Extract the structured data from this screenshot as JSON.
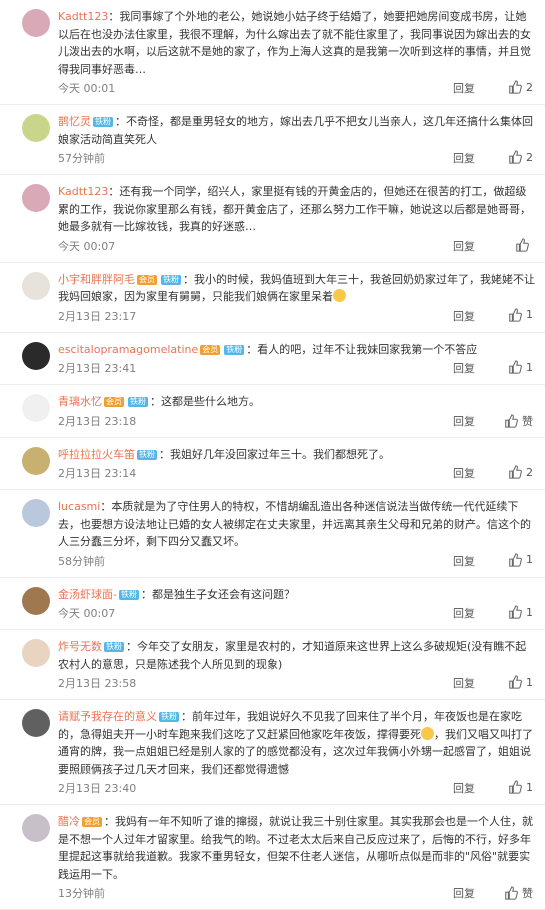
{
  "reply_label": "回复",
  "comments": [
    {
      "user": "Kadtt123",
      "badges": [],
      "text": "：我同事嫁了个外地的老公，她说她小姑子终于结婚了，她要把她房间变成书房，让她以后在也没办法住家里，我很不理解，为什么嫁出去了就不能住家里了，我同事说因为嫁出去的女儿泼出去的水啊，以后这就不是她的家了，作为上海人这真的是我第一次听到这样的事情，并且觉得我同事好恶毒…",
      "time": "今天 00:01",
      "likes": "2"
    },
    {
      "user": "鹊忆灵",
      "badges": [
        "铁粉"
      ],
      "text": "：不奇怪，都是重男轻女的地方，嫁出去几乎不把女儿当亲人，这几年还搞什么集体回娘家活动简直笑死人",
      "time": "57分钟前",
      "likes": "2"
    },
    {
      "user": "Kadtt123",
      "badges": [],
      "text": "：还有我一个同学，绍兴人，家里挺有钱的开黄金店的，但她还在很苦的打工，做超级累的工作，我说你家里那么有钱，都开黄金店了，还那么努力工作干嘛，她说这以后都是她哥哥，她最多就有一比嫁妆钱，我真的好迷惑…",
      "time": "今天 00:07",
      "likes": ""
    },
    {
      "user": "小宇和胖胖阿毛",
      "badges": [
        "会员",
        "铁粉"
      ],
      "text": "：我小的时候，我妈值班到大年三十，我爸回奶奶家过年了，我姥姥不让我妈回娘家，因为家里有舅舅，只能我们娘俩在家里呆着",
      "time": "2月13日 23:17",
      "likes": "1",
      "emoji": true
    },
    {
      "user": "escitalopramagomelatine",
      "badges": [
        "会员",
        "铁粉"
      ],
      "text": "：看人的吧，过年不让我妹回家我第一个不答应",
      "time": "2月13日 23:41",
      "likes": "1"
    },
    {
      "user": "青璃水忆",
      "badges": [
        "会员",
        "铁粉"
      ],
      "text": "：这都是些什么地方。",
      "time": "2月13日 23:18",
      "likes": "赞"
    },
    {
      "user": "呼拉拉拉火车笛",
      "badges": [
        "铁粉"
      ],
      "text": "：我姐好几年没回家过年三十。我们都想死了。",
      "time": "2月13日 23:14",
      "likes": "2"
    },
    {
      "user": "lucasmi",
      "badges": [],
      "text": "：本质就是为了守住男人的特权，不惜胡编乱造出各种迷信说法当做传统一代代延续下去，也要想方设法地让已婚的女人被绑定在丈夫家里，并远离其亲生父母和兄弟的财产。信这个的人三分蠢三分坏，剩下四分又蠢又坏。",
      "time": "58分钟前",
      "likes": "1"
    },
    {
      "user": "金汤虾球面-",
      "badges": [
        "铁粉"
      ],
      "text": "：都是独生子女还会有这问题？",
      "time": "今天 00:07",
      "likes": "1"
    },
    {
      "user": "炸号无数",
      "badges": [
        "铁粉"
      ],
      "text": "：今年交了女朋友，家里是农村的，才知道原来这世界上这么多破规矩(没有瞧不起农村人的意思，只是陈述我个人所见到的现象)",
      "time": "2月13日 23:58",
      "likes": "1"
    },
    {
      "user": "请赋予我存在的意义",
      "badges": [
        "铁粉"
      ],
      "text": "：前年过年，我姐说好久不见我了回来住了半个月，年夜饭也是在家吃的，急得姐夫开一小时车跑来我们这吃了又赶紧回他家吃年夜饭，撑得要死",
      "text2": "，我们又唱又叫打了通宵的牌，我一点姐姐已经是别人家的了的感觉都没有，这次过年我俩小外甥一起感冒了，姐姐说要照顾俩孩子过几天才回来，我们还都觉得遗憾",
      "time": "2月13日 23:40",
      "likes": "1",
      "emoji": true
    },
    {
      "user": "醋冷",
      "badges": [
        "会员"
      ],
      "text": "：我妈有一年不知听了谁的撺掇，就说让我三十别住家里。其实我那会也是一个人住，就是不想一个人过年才留家里。给我气的哟。不过老太太后来自己反应过来了，后悔的不行，好多年里提起这事就给我道歉。我家不重男轻女，但架不住老人迷信，从哪听点似是而非的\"风俗\"就要实践运用一下。",
      "time": "13分钟前",
      "likes": "赞"
    }
  ]
}
